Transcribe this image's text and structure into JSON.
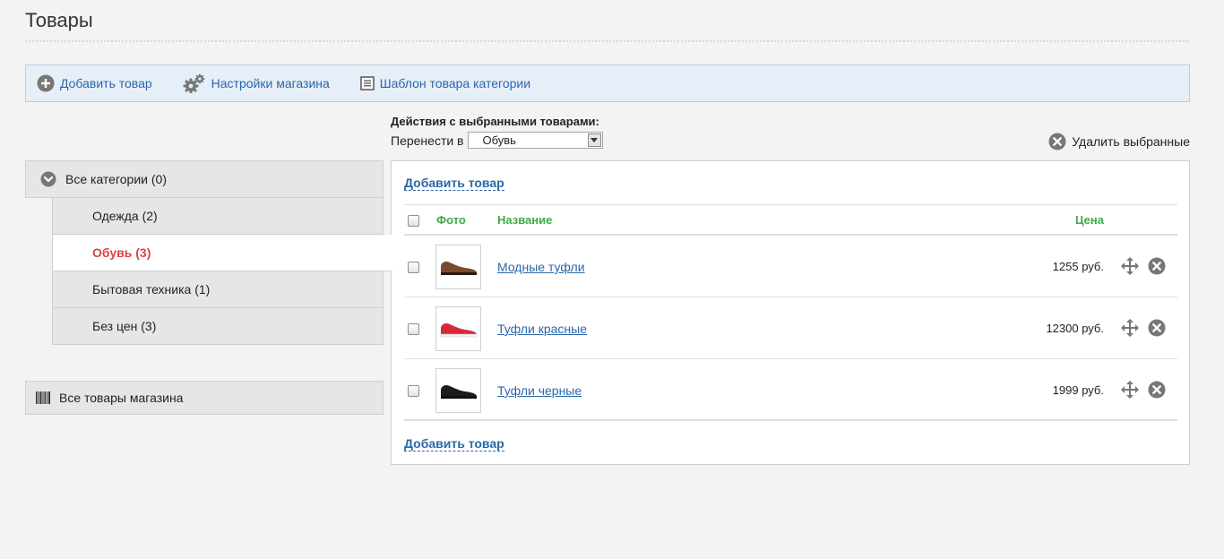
{
  "page": {
    "title": "Товары"
  },
  "toolbar": {
    "add_product": "Добавить товар",
    "shop_settings": "Настройки магазина",
    "category_template": "Шаблон товара категории"
  },
  "bulk": {
    "title": "Действия с выбранными товарами:",
    "move_label": "Перенести в",
    "move_target": "Обувь",
    "delete_selected": "Удалить выбранные"
  },
  "categories": {
    "root": "Все категории (0)",
    "items": [
      {
        "label": "Одежда (2)",
        "active": false
      },
      {
        "label": "Обувь (3)",
        "active": true
      },
      {
        "label": "Бытовая техника (1)",
        "active": false
      },
      {
        "label": "Без цен (3)",
        "active": false
      }
    ],
    "all_products": "Все товары магазина"
  },
  "panel": {
    "add_top": "Добавить товар",
    "add_bottom": "Добавить товар",
    "columns": {
      "photo": "Фото",
      "name": "Название",
      "price": "Цена"
    },
    "products": [
      {
        "name": "Модные туфли",
        "price": "1255 руб.",
        "shoe_color": "#7a4a2e"
      },
      {
        "name": "Туфли красные",
        "price": "12300 руб.",
        "shoe_color": "#d8283b"
      },
      {
        "name": "Туфли черные",
        "price": "1999 руб.",
        "shoe_color": "#1c1c1c"
      }
    ]
  },
  "colors": {
    "link": "#2b67a8",
    "header_green": "#3bab4a",
    "active_category": "#d94444",
    "toolbar_bg": "#e6eef8"
  },
  "icons": {
    "add": "plus-circle-icon",
    "settings": "gears-icon",
    "template": "list-document-icon",
    "delete": "x-circle-icon",
    "collapse": "chevron-down-circle-icon",
    "barcode": "barcode-icon",
    "move": "move-arrows-icon"
  }
}
